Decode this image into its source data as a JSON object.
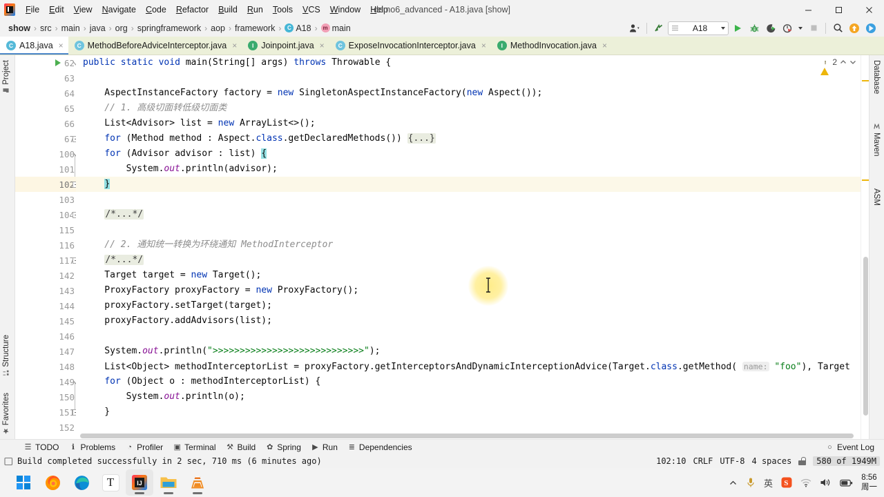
{
  "window": {
    "title": "demo6_advanced - A18.java [show]",
    "controls": {
      "minimize": "─",
      "maximize": "❐",
      "close": "✕"
    }
  },
  "menubar": {
    "items": [
      {
        "label": "File"
      },
      {
        "label": "Edit"
      },
      {
        "label": "View"
      },
      {
        "label": "Navigate"
      },
      {
        "label": "Code"
      },
      {
        "label": "Refactor"
      },
      {
        "label": "Build"
      },
      {
        "label": "Run"
      },
      {
        "label": "Tools"
      },
      {
        "label": "VCS"
      },
      {
        "label": "Window"
      },
      {
        "label": "Help"
      }
    ]
  },
  "breadcrumb": {
    "items": [
      {
        "label": "show",
        "icon": ""
      },
      {
        "label": "src",
        "icon": ""
      },
      {
        "label": "main",
        "icon": ""
      },
      {
        "label": "java",
        "icon": ""
      },
      {
        "label": "org",
        "icon": ""
      },
      {
        "label": "springframework",
        "icon": ""
      },
      {
        "label": "aop",
        "icon": ""
      },
      {
        "label": "framework",
        "icon": ""
      },
      {
        "label": "A18",
        "icon": "class-icon"
      },
      {
        "label": "main",
        "icon": "method-icon"
      }
    ],
    "separator": "›"
  },
  "toolbar": {
    "run_config": "A18",
    "icons": [
      "user-settings-icon",
      "update-project-icon",
      "run-icon",
      "debug-icon",
      "run-coverage-icon",
      "profile-icon",
      "stop-icon",
      "search-everywhere-icon",
      "notifications-icon",
      "ide-features-icon"
    ]
  },
  "tabs": [
    {
      "label": "A18.java",
      "icon": "class-icon",
      "active": true,
      "close": "×"
    },
    {
      "label": "MethodBeforeAdviceInterceptor.java",
      "icon": "class-icon",
      "active": false,
      "close": "×"
    },
    {
      "label": "Joinpoint.java",
      "icon": "interface-icon",
      "active": false,
      "close": "×"
    },
    {
      "label": "ExposeInvocationInterceptor.java",
      "icon": "class-icon",
      "active": false,
      "close": "×"
    },
    {
      "label": "MethodInvocation.java",
      "icon": "interface-icon",
      "active": false,
      "close": "×"
    }
  ],
  "sidebar_left": {
    "top": [
      {
        "label": "Project",
        "icon": "project-icon"
      }
    ],
    "bottom": [
      {
        "label": "Structure",
        "icon": "structure-icon"
      },
      {
        "label": "Favorites",
        "icon": "star-icon"
      }
    ]
  },
  "sidebar_right": {
    "items": [
      {
        "label": "Database",
        "icon": "database-icon"
      },
      {
        "label": "Maven",
        "icon": "maven-icon"
      },
      {
        "label": "ASM",
        "icon": "asm-icon"
      }
    ]
  },
  "editor": {
    "inspection": {
      "warning_count": "2",
      "up": "∧",
      "down": "∨"
    },
    "lines": [
      {
        "num": "62",
        "indent": 0,
        "run_marker": true,
        "fold": "collapse-arrow",
        "segments": [
          {
            "t": "public ",
            "c": "kw"
          },
          {
            "t": "static ",
            "c": "kw"
          },
          {
            "t": "void ",
            "c": "kw"
          },
          {
            "t": "main(String[] args) ",
            "c": ""
          },
          {
            "t": "throws ",
            "c": "kw"
          },
          {
            "t": "Throwable {",
            "c": ""
          }
        ]
      },
      {
        "num": "63",
        "segments": []
      },
      {
        "num": "64",
        "segments": [
          {
            "t": "    AspectInstanceFactory factory = ",
            "c": ""
          },
          {
            "t": "new ",
            "c": "kw"
          },
          {
            "t": "SingletonAspectInstanceFactory(",
            "c": ""
          },
          {
            "t": "new ",
            "c": "kw"
          },
          {
            "t": "Aspect());",
            "c": ""
          }
        ]
      },
      {
        "num": "65",
        "segments": [
          {
            "t": "    // 1. 高级切面转低级切面类",
            "c": "cmt"
          }
        ]
      },
      {
        "num": "66",
        "segments": [
          {
            "t": "    List<Advisor> list = ",
            "c": ""
          },
          {
            "t": "new ",
            "c": "kw"
          },
          {
            "t": "ArrayList<>();",
            "c": ""
          }
        ]
      },
      {
        "num": "67",
        "fold": "expand-box",
        "segments": [
          {
            "t": "    ",
            "c": ""
          },
          {
            "t": "for ",
            "c": "kw"
          },
          {
            "t": "(Method method : Aspect.",
            "c": ""
          },
          {
            "t": "class",
            "c": "kw"
          },
          {
            "t": ".getDeclaredMethods()) ",
            "c": ""
          },
          {
            "t": "{...}",
            "c": "fld"
          }
        ]
      },
      {
        "num": "100",
        "fold": "collapse-arrow",
        "segments": [
          {
            "t": "    ",
            "c": ""
          },
          {
            "t": "for ",
            "c": "kw"
          },
          {
            "t": "(Advisor advisor : list) ",
            "c": ""
          },
          {
            "t": "{",
            "c": "brace-hl"
          }
        ]
      },
      {
        "num": "101",
        "segments": [
          {
            "t": "        System.",
            "c": ""
          },
          {
            "t": "out",
            "c": "stat"
          },
          {
            "t": ".println(advisor);",
            "c": ""
          }
        ]
      },
      {
        "num": "102",
        "current": true,
        "fold": "collapse-box",
        "segments": [
          {
            "t": "    ",
            "c": ""
          },
          {
            "t": "}",
            "c": "brace-hl"
          }
        ]
      },
      {
        "num": "103",
        "segments": []
      },
      {
        "num": "104",
        "fold": "expand-box",
        "segments": [
          {
            "t": "    ",
            "c": ""
          },
          {
            "t": "/*...*/",
            "c": "fld"
          }
        ]
      },
      {
        "num": "115",
        "segments": []
      },
      {
        "num": "116",
        "segments": [
          {
            "t": "    // 2. 通知统一转换为环绕通知 MethodInterceptor",
            "c": "cmt"
          }
        ]
      },
      {
        "num": "117",
        "fold": "expand-box",
        "segments": [
          {
            "t": "    ",
            "c": ""
          },
          {
            "t": "/*...*/",
            "c": "fld"
          }
        ]
      },
      {
        "num": "142",
        "segments": [
          {
            "t": "    Target target = ",
            "c": ""
          },
          {
            "t": "new ",
            "c": "kw"
          },
          {
            "t": "Target();",
            "c": ""
          }
        ]
      },
      {
        "num": "143",
        "segments": [
          {
            "t": "    ProxyFactory proxyFactory = ",
            "c": ""
          },
          {
            "t": "new ",
            "c": "kw"
          },
          {
            "t": "ProxyFactory();",
            "c": ""
          }
        ]
      },
      {
        "num": "144",
        "segments": [
          {
            "t": "    proxyFactory.setTarget(target);",
            "c": ""
          }
        ]
      },
      {
        "num": "145",
        "segments": [
          {
            "t": "    proxyFactory.addAdvisors(list);",
            "c": ""
          }
        ]
      },
      {
        "num": "146",
        "segments": []
      },
      {
        "num": "147",
        "segments": [
          {
            "t": "    System.",
            "c": ""
          },
          {
            "t": "out",
            "c": "stat"
          },
          {
            "t": ".println(",
            "c": ""
          },
          {
            "t": "\">>>>>>>>>>>>>>>>>>>>>>>>>>>>\"",
            "c": "str"
          },
          {
            "t": ");",
            "c": ""
          }
        ]
      },
      {
        "num": "148",
        "segments": [
          {
            "t": "    List<Object> methodInterceptorList = proxyFactory.getInterceptorsAndDynamicInterceptionAdvice(Target.",
            "c": ""
          },
          {
            "t": "class",
            "c": "kw"
          },
          {
            "t": ".getMethod( ",
            "c": ""
          },
          {
            "t": "name:",
            "c": "hint"
          },
          {
            "t": " ",
            "c": ""
          },
          {
            "t": "\"foo\"",
            "c": "str"
          },
          {
            "t": "), Target",
            "c": ""
          }
        ]
      },
      {
        "num": "149",
        "fold": "collapse-arrow",
        "segments": [
          {
            "t": "    ",
            "c": ""
          },
          {
            "t": "for ",
            "c": "kw"
          },
          {
            "t": "(Object o : methodInterceptorList) {",
            "c": ""
          }
        ]
      },
      {
        "num": "150",
        "segments": [
          {
            "t": "        System.",
            "c": ""
          },
          {
            "t": "out",
            "c": "stat"
          },
          {
            "t": ".println(o);",
            "c": ""
          }
        ]
      },
      {
        "num": "151",
        "fold": "collapse-box",
        "segments": [
          {
            "t": "    }",
            "c": ""
          }
        ]
      },
      {
        "num": "152",
        "segments": []
      }
    ]
  },
  "tool_windows": [
    {
      "label": "TODO",
      "icon": "todo-icon"
    },
    {
      "label": "Problems",
      "icon": "problems-icon"
    },
    {
      "label": "Profiler",
      "icon": "profiler-icon"
    },
    {
      "label": "Terminal",
      "icon": "terminal-icon"
    },
    {
      "label": "Build",
      "icon": "build-icon"
    },
    {
      "label": "Spring",
      "icon": "spring-icon"
    },
    {
      "label": "Run",
      "icon": "run-icon"
    },
    {
      "label": "Dependencies",
      "icon": "dependencies-icon"
    }
  ],
  "event_log": {
    "label": "Event Log",
    "icon": "event-log-icon"
  },
  "statusbar": {
    "message": "Build completed successfully in 2 sec, 710 ms (6 minutes ago)",
    "message_icon": "build-status-icon",
    "caret_position": "102:10",
    "line_separator": "CRLF",
    "encoding": "UTF-8",
    "indent": "4 spaces",
    "lock_icon": "lock-icon",
    "memory": "580 of 1949M"
  },
  "taskbar": {
    "apps": [
      {
        "name": "start-button"
      },
      {
        "name": "firefox-icon"
      },
      {
        "name": "edge-icon"
      },
      {
        "name": "typora-icon",
        "label": "T"
      },
      {
        "name": "intellij-idea-icon",
        "active": true
      },
      {
        "name": "file-explorer-icon",
        "running": true
      },
      {
        "name": "vlc-icon",
        "running": true
      }
    ],
    "tray": [
      {
        "name": "show-hidden-icons",
        "glyph": "∧"
      },
      {
        "name": "microphone-icon"
      },
      {
        "name": "ime-icon",
        "glyph": "英"
      },
      {
        "name": "sogou-input-icon",
        "glyph": "S"
      },
      {
        "name": "wifi-icon"
      },
      {
        "name": "volume-icon"
      },
      {
        "name": "battery-icon"
      }
    ],
    "clock": {
      "time": "8:56",
      "date": "周一"
    }
  },
  "colors": {
    "accent_blue": "#4a86c8",
    "tab_bg": "#ecf0d9",
    "keyword": "#0033b3",
    "string": "#067d17",
    "comment": "#8c8c8c",
    "warning": "#edb60b",
    "current_line": "#fcf8e8"
  }
}
